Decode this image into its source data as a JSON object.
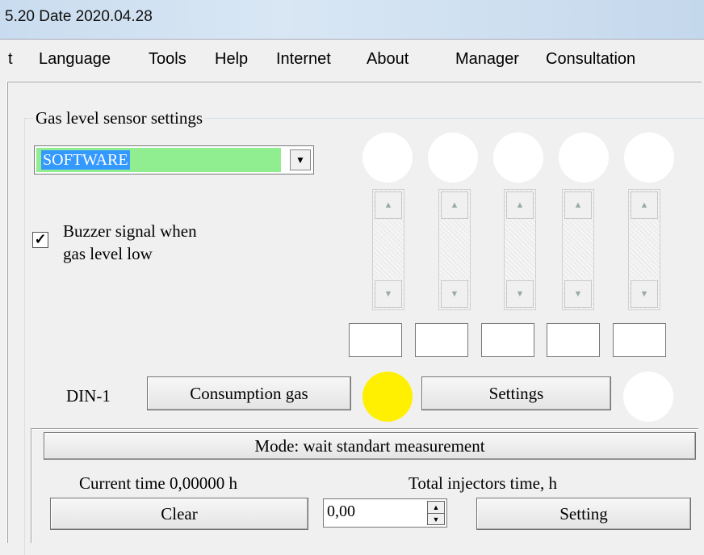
{
  "window": {
    "title": "5.20  Date 2020.04.28"
  },
  "menu": {
    "items": [
      "t",
      "Language",
      "Tools",
      "Help",
      "Internet",
      "About",
      "Manager",
      "Consultation"
    ]
  },
  "gas_sensor": {
    "group_title": "Gas level sensor settings",
    "mode_selected": "SOFTWARE",
    "buzzer_checked": true,
    "buzzer_line1": "Buzzer signal when",
    "buzzer_line2": "gas level low",
    "values": [
      "",
      "",
      "",
      "",
      ""
    ]
  },
  "din": {
    "label": "DIN-1",
    "consumption_button": "Consumption gas",
    "settings_button": "Settings"
  },
  "measurement": {
    "mode_button": "Mode: wait standart measurement",
    "current_time": "Current time 0,00000 h",
    "total_injectors": "Total injectors time, h",
    "clear_button": "Clear",
    "time_value": "0,00",
    "setting_button": "Setting"
  },
  "colors": {
    "combo_field": "#90ee90",
    "selection": "#3399ff",
    "led_on": "#ffef00",
    "led_off": "#ffffff"
  }
}
